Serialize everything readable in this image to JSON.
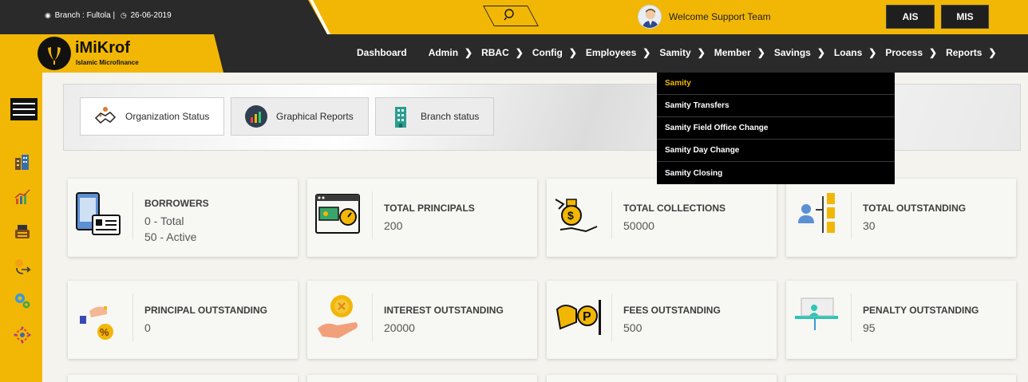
{
  "topbar": {
    "branch": "Branch : Fultola |",
    "date": "26-06-2019",
    "welcome": "Welcome Support Team",
    "buttons": [
      "AIS",
      "MIS"
    ]
  },
  "brand": {
    "name": "iMiKrof",
    "tagline": "Islamic Microfinance"
  },
  "nav": {
    "items": [
      "Dashboard",
      "Admin",
      "RBAC",
      "Config",
      "Employees",
      "Samity",
      "Member",
      "Savings",
      "Loans",
      "Process",
      "Reports"
    ]
  },
  "dropdown": {
    "items": [
      "Samity",
      "Samity Transfers",
      "Samity Field Office Change",
      "Samity Day Change",
      "Samity Closing"
    ]
  },
  "tabs": [
    "Organization Status",
    "Graphical Reports",
    "Branch status"
  ],
  "cards": [
    {
      "title": "BORROWERS",
      "values": [
        "0 - Total",
        "50 - Active"
      ]
    },
    {
      "title": "TOTAL PRINCIPALS",
      "values": [
        "200"
      ]
    },
    {
      "title": "TOTAL COLLECTIONS",
      "values": [
        "50000"
      ]
    },
    {
      "title": "TOTAL OUTSTANDING",
      "values": [
        "30"
      ]
    },
    {
      "title": "PRINCIPAL OUTSTANDING",
      "values": [
        "0"
      ]
    },
    {
      "title": "INTEREST OUTSTANDING",
      "values": [
        "20000"
      ]
    },
    {
      "title": "FEES OUTSTANDING",
      "values": [
        "500"
      ]
    },
    {
      "title": "PENALTY OUTSTANDING",
      "values": [
        "95"
      ]
    }
  ],
  "colors": {
    "brand_yellow": "#f2b705",
    "dark": "#2a2a2a"
  }
}
